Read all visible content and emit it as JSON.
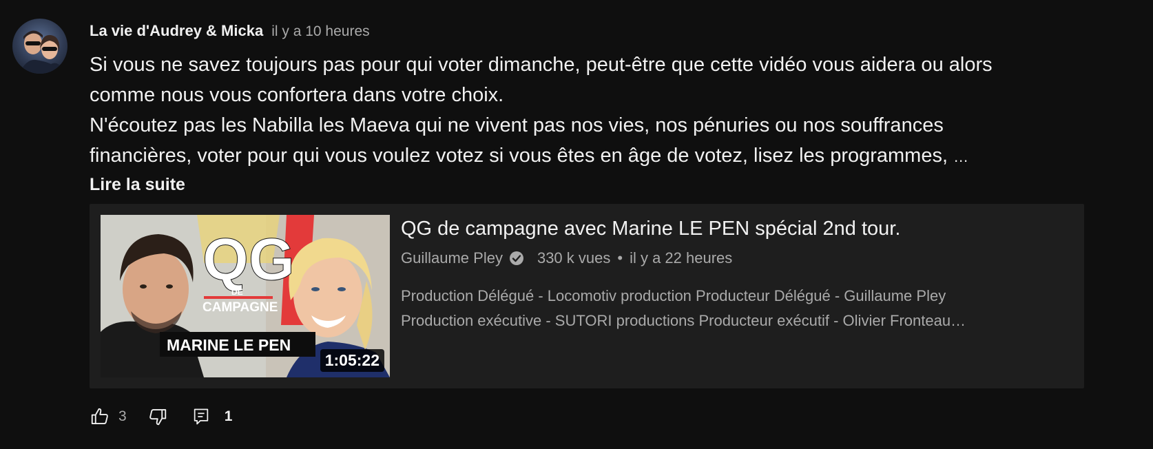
{
  "post": {
    "author": "La vie d'Audrey & Micka",
    "time": "il y a 10 heures",
    "lines": [
      "Si vous ne savez toujours pas pour qui voter dimanche, peut-être que cette vidéo vous aidera ou alors",
      "comme nous vous confortera dans votre choix.",
      "N'écoutez pas les Nabilla les Maeva qui ne vivent pas nos vies, nos pénuries ou nos souffrances",
      "financières, voter pour qui vous voulez votez si vous êtes en âge de votez, lisez les programmes,"
    ],
    "ellipsis": "…",
    "read_more": "Lire la suite"
  },
  "video": {
    "title": "QG de campagne avec Marine LE PEN spécial 2nd tour.",
    "channel": "Guillaume Pley",
    "views": "330 k vues",
    "separator": "•",
    "age": "il y a 22 heures",
    "description_lines": [
      "Production Délégué - Locomotiv production Producteur Délégué - Guillaume Pley",
      "Production exécutive - SUTORI productions Producteur exécutif - Olivier Fronteau…"
    ],
    "duration": "1:05:22",
    "thumbnail": {
      "big_text": "QG",
      "small_de": "DE",
      "campagne": "CAMPAGNE",
      "banner": "MARINE LE PEN"
    }
  },
  "actions": {
    "like_count": "3",
    "reply_count": "1"
  },
  "icons": {
    "like": "thumb-up-icon",
    "dislike": "thumb-down-icon",
    "reply": "comment-icon",
    "verified": "verified-check-icon"
  },
  "colors": {
    "background": "#0f0f0f",
    "card": "#1e1e1e",
    "text": "#f1f1f1",
    "secondary_text": "#aaaaaa"
  }
}
